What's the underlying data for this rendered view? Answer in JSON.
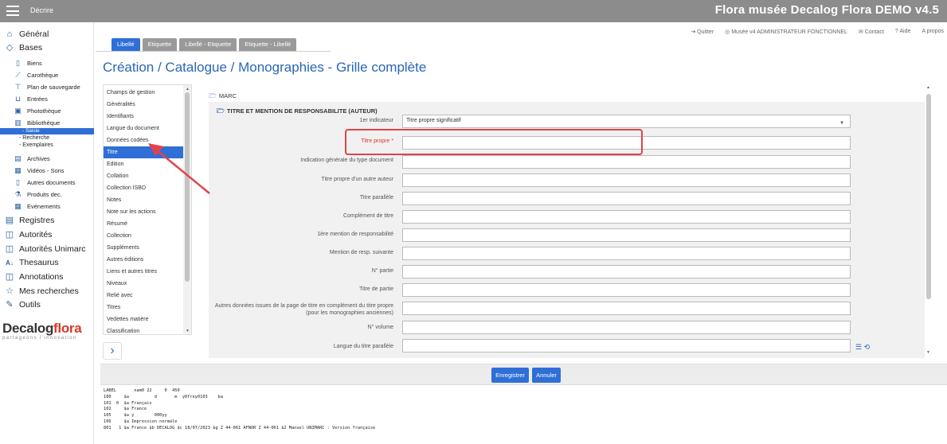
{
  "topbar": {
    "menu_label": "Décrire",
    "app_title": "Flora musée Decalog Flora DEMO v4.5"
  },
  "sidebar": {
    "top_items": [
      {
        "label": "Général",
        "icon": "home-icon"
      },
      {
        "label": "Bases",
        "icon": "tag-icon"
      }
    ],
    "bases_items": [
      {
        "label": "Biens",
        "icon": "document-icon"
      },
      {
        "label": "Carothèque",
        "icon": "drill-icon"
      },
      {
        "label": "Plan de sauvegarde",
        "icon": "pin-icon"
      },
      {
        "label": "Entrées",
        "icon": "inbox-icon"
      },
      {
        "label": "Photothèque",
        "icon": "image-icon"
      },
      {
        "label": "Bibliothèque",
        "icon": "books-icon"
      }
    ],
    "bibliotheque_sub": [
      "- Saisie",
      "- Recherche",
      "- Exemplaires"
    ],
    "bases_items_2": [
      {
        "label": "Archives",
        "icon": "archive-icon"
      },
      {
        "label": "Vidéos - Sons",
        "icon": "media-icon"
      },
      {
        "label": "Autres documents",
        "icon": "file-icon"
      },
      {
        "label": "Produits dec.",
        "icon": "flask-icon"
      },
      {
        "label": "Evénements",
        "icon": "calendar-icon"
      }
    ],
    "bottom_items": [
      {
        "label": "Registres",
        "icon": "registers-icon"
      },
      {
        "label": "Autorités",
        "icon": "book-open-icon"
      },
      {
        "label": "Autorités Unimarc",
        "icon": "book-open-icon"
      },
      {
        "label": "Thesaurus",
        "icon": "sort-az-icon"
      },
      {
        "label": "Annotations",
        "icon": "book-open-icon"
      },
      {
        "label": "Mes recherches",
        "icon": "star-icon"
      },
      {
        "label": "Outils",
        "icon": "wrench-icon"
      }
    ],
    "logo_main": "Decalog",
    "logo_accent": "flora",
    "logo_tagline": "partageons l'innovation"
  },
  "utilbar": {
    "quit": "Quitter",
    "user": "Musée v4 ADMINISTRATEUR FONCTIONNEL",
    "contact": "Contact",
    "help": "Aide",
    "about": "A propos"
  },
  "tabs": [
    "Libellé",
    "Etiquette",
    "Libellé - Etiquette",
    "Etiquette - Libellé"
  ],
  "page_title": "Création / Catalogue / Monographies - Grille complète",
  "left_panel": {
    "items": [
      "Champs de gestion",
      "Généralités",
      "Identifiants",
      "Langue du document",
      "Données codées",
      "Titre",
      "Edition",
      "Collation",
      "Collection ISBD",
      "Notes",
      "Note sur les actions",
      "Résumé",
      "Collection",
      "Suppléments",
      "Autres éditions",
      "Liens et autres titres",
      "Niveaux",
      "Relié avec",
      "Titres",
      "Vedettes matière",
      "Classification"
    ],
    "active": "Titre"
  },
  "form": {
    "marc_label": "MARC",
    "section_title": "TITRE ET MENTION DE RESPONSABILITE (AUTEUR)",
    "fields": [
      {
        "label": "1er indicateur",
        "value": "Titre propre significatif"
      },
      {
        "label": "Titre propre *",
        "value": ""
      },
      {
        "label": "Indication générale du type document",
        "value": ""
      },
      {
        "label": "Titre propre d'un autre auteur",
        "value": ""
      },
      {
        "label": "Titre parallèle",
        "value": ""
      },
      {
        "label": "Complément de titre",
        "value": ""
      },
      {
        "label": "1ère mention de responsabilité",
        "value": ""
      },
      {
        "label": "Mention de resp. suivante",
        "value": ""
      },
      {
        "label": "N° partie",
        "value": ""
      },
      {
        "label": "Titre de partie",
        "value": ""
      },
      {
        "label": "Autres données issues de la page de titre en complément du titre propre (pour les monographies anciennes)",
        "value": ""
      },
      {
        "label": "N° volume",
        "value": ""
      },
      {
        "label": "Langue du titre parallèle",
        "value": ""
      }
    ]
  },
  "buttons": {
    "save": "Enregistrer",
    "cancel": "Annuler"
  },
  "marc_record": [
    "LABEL       nam0 22     0  450",
    "100     $a          d       m  y0frey0103    ba",
    "101  0  $a Français",
    "102     $a France",
    "105     $a y        000yy",
    "106     $a Impression normale",
    "801   1 $a France $b DECALOG $c 18/07/2023 $g Z 44-061 AFNOR Z 44-061 $2 Manuel UNIMARC : Version française"
  ],
  "colors": {
    "accent": "#2f6fd6",
    "title": "#2b66b3",
    "required": "#d9372b",
    "highlight": "#e0434b"
  }
}
